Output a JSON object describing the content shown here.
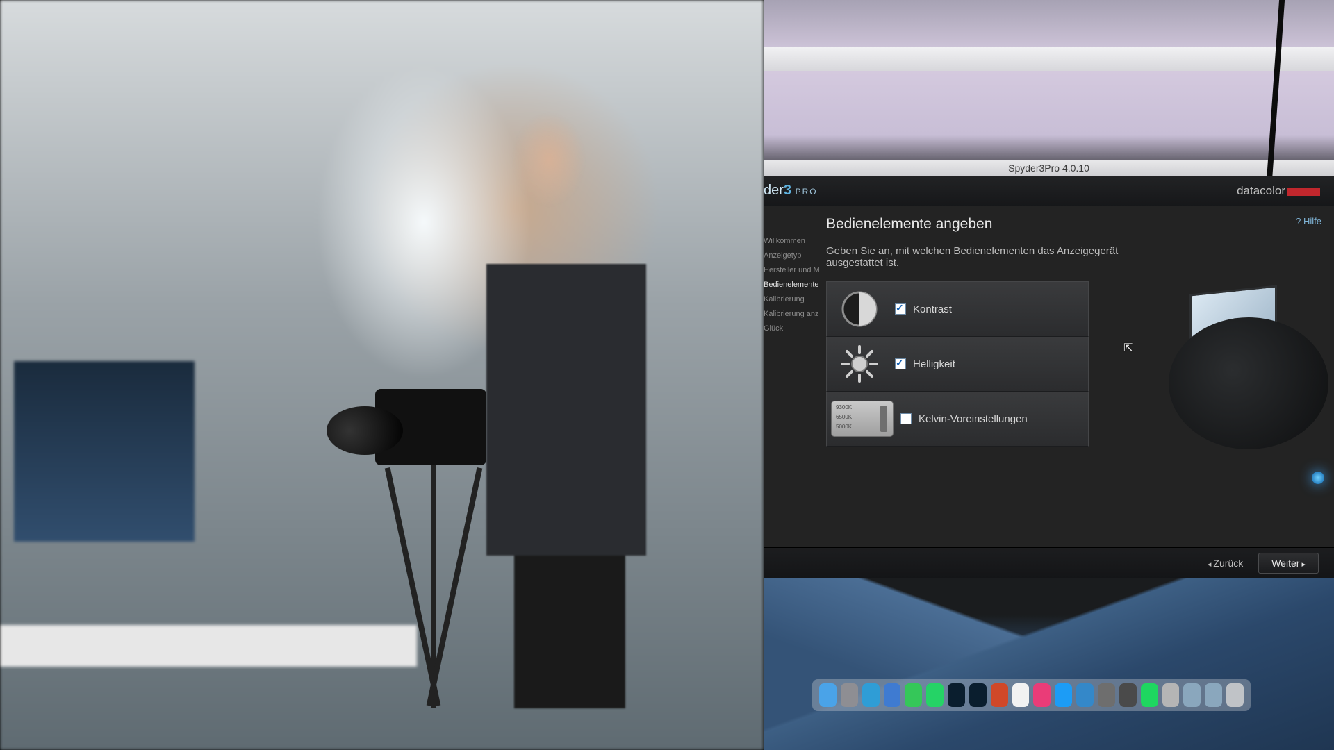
{
  "window": {
    "title": "Spyder3Pro 4.0.10"
  },
  "brand": {
    "name_prefix": "der",
    "name_digit": "3",
    "name_suffix": "PRO",
    "company": "datacolor"
  },
  "help": {
    "label": "Hilfe"
  },
  "page": {
    "heading": "Bedienelemente angeben",
    "subheading": "Geben Sie an, mit welchen Bedienelementen das Anzeigegerät ausgestattet ist."
  },
  "sidebar": {
    "items": [
      {
        "label": "Willkommen"
      },
      {
        "label": "Anzeigetyp"
      },
      {
        "label": "Hersteller und Modell"
      },
      {
        "label": "Bedienelemente angeben",
        "active": true
      },
      {
        "label": "Kalibrierung"
      },
      {
        "label": "Kalibrierung anzeigen"
      },
      {
        "label": "Glück"
      }
    ]
  },
  "options": [
    {
      "id": "kontrast",
      "label": "Kontrast",
      "checked": true,
      "icon": "contrast-icon"
    },
    {
      "id": "helligkeit",
      "label": "Helligkeit",
      "checked": true,
      "icon": "brightness-icon"
    },
    {
      "id": "kelvin",
      "label": "Kelvin-Voreinstellungen",
      "checked": false,
      "icon": "kelvin-icon",
      "presets": [
        "9300K",
        "6500K",
        "5000K"
      ]
    }
  ],
  "footer": {
    "back": "Zurück",
    "next": "Weiter"
  },
  "dock": {
    "apps": [
      {
        "name": "finder",
        "color": "#4aa3e8"
      },
      {
        "name": "launchpad",
        "color": "#8e8e93"
      },
      {
        "name": "safari",
        "color": "#2f9dd6"
      },
      {
        "name": "mail",
        "color": "#3f7bd1"
      },
      {
        "name": "messages",
        "color": "#35c759"
      },
      {
        "name": "whatsapp",
        "color": "#25d366"
      },
      {
        "name": "lightroom",
        "color": "#0a1e2e"
      },
      {
        "name": "photoshop",
        "color": "#0a1e2e"
      },
      {
        "name": "capture",
        "color": "#d04828"
      },
      {
        "name": "photos",
        "color": "#f2f2f2"
      },
      {
        "name": "itunes",
        "color": "#ea3c78"
      },
      {
        "name": "appstore",
        "color": "#1c9cf6"
      },
      {
        "name": "preview",
        "color": "#3488c9"
      },
      {
        "name": "app1",
        "color": "#6e6e6e"
      },
      {
        "name": "app2",
        "color": "#4a4a4a"
      },
      {
        "name": "spotify",
        "color": "#1ed760"
      },
      {
        "name": "spyder",
        "color": "#b5b5b5"
      },
      {
        "name": "downloads",
        "color": "#8aa7bd"
      },
      {
        "name": "documents",
        "color": "#8aa7bd"
      },
      {
        "name": "trash",
        "color": "#c0c3c7"
      }
    ]
  }
}
